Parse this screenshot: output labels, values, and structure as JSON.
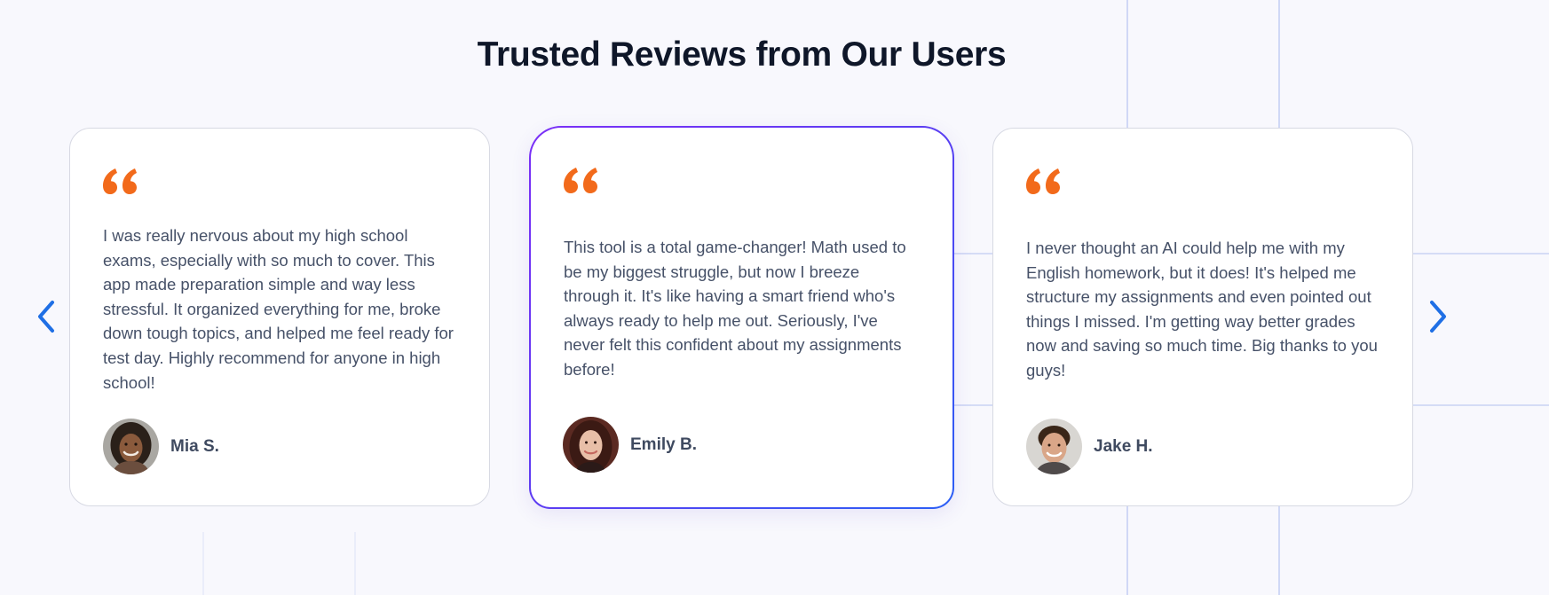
{
  "section": {
    "title": "Trusted Reviews from Our Users"
  },
  "navigation": {
    "prev_icon": "chevron-left-icon",
    "next_icon": "chevron-right-icon"
  },
  "reviews": [
    {
      "text": "I was really nervous about my high school exams, especially with so much to cover. This app made preparation simple and way less stressful. It organized everything for me, broke down tough topics, and helped me feel ready for test day. Highly recommend for anyone in high school!",
      "author": "Mia S."
    },
    {
      "text": "This tool is a total game-changer! Math used to be my biggest struggle, but now I breeze through it. It's like having a smart friend who's always ready to help me out. Seriously, I've never felt this confident about my assignments before!",
      "author": "Emily B.",
      "featured": true
    },
    {
      "text": "I never thought an AI could help me with my English homework, but it does! It's helped me structure my assignments and even pointed out things I missed. I'm getting way better grades now and saving so much time. Big thanks to you guys!",
      "author": "Jake H."
    }
  ],
  "colors": {
    "quote_accent": "#f26a1b",
    "arrow": "#1f6fe5",
    "featured_border_start": "#7b2ff7",
    "featured_border_end": "#2b5ff5",
    "title": "#0f1729",
    "body_text": "#465168"
  }
}
